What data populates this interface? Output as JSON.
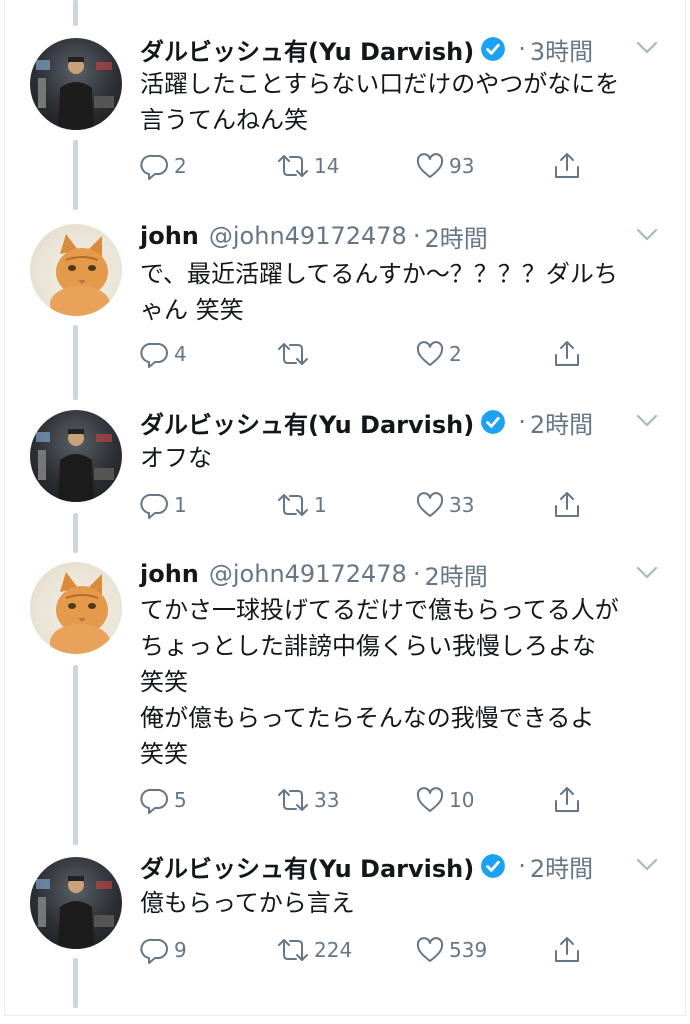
{
  "tweets": [
    {
      "author": "ダルビッシュ有(Yu Darvish)",
      "handle": "",
      "verified": true,
      "time": "3時間",
      "text": "活躍したことすらない口だけのやつがなにを\n言うてんねん笑",
      "replies": "2",
      "retweets": "14",
      "likes": "93",
      "avatar": "yu-darvish-avatar"
    },
    {
      "author": "john",
      "handle": "@john49172478",
      "verified": false,
      "time": "2時間",
      "text": "で、最近活躍してるんすか〜？？？？ダルち\nゃん 笑笑",
      "replies": "4",
      "retweets": "",
      "likes": "2",
      "avatar": "cat-avatar"
    },
    {
      "author": "ダルビッシュ有(Yu Darvish)",
      "handle": "",
      "verified": true,
      "time": "2時間",
      "text": "オフな",
      "replies": "1",
      "retweets": "1",
      "likes": "33",
      "avatar": "yu-darvish-avatar"
    },
    {
      "author": "john",
      "handle": "@john49172478",
      "verified": false,
      "time": "2時間",
      "text": "てかさ一球投げてるだけで億もらってる人が\nちょっとした誹謗中傷くらい我慢しろよな\n笑笑\n俺が億もらってたらそんなの我慢できるよ\n笑笑",
      "replies": "5",
      "retweets": "33",
      "likes": "10",
      "avatar": "cat-avatar"
    },
    {
      "author": "ダルビッシュ有(Yu Darvish)",
      "handle": "",
      "verified": true,
      "time": "2時間",
      "text": "億もらってから言え",
      "replies": "9",
      "retweets": "224",
      "likes": "539",
      "avatar": "yu-darvish-avatar"
    }
  ],
  "separator_dot": "·",
  "colors": {
    "verified": "#1da1f2",
    "muted": "#657786",
    "thread_line": "#ccd6dd"
  }
}
